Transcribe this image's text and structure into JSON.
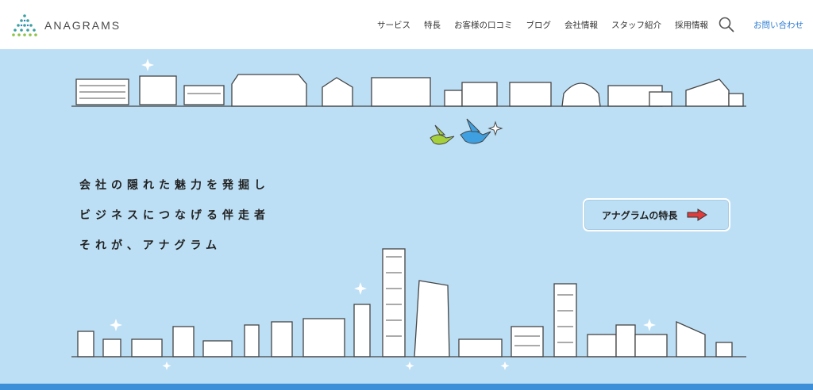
{
  "header": {
    "logo_text": "ANAGRAMS",
    "nav": [
      {
        "label": "サービス"
      },
      {
        "label": "特長"
      },
      {
        "label": "お客様の口コミ"
      },
      {
        "label": "ブログ"
      },
      {
        "label": "会社情報"
      },
      {
        "label": "スタッフ紹介"
      },
      {
        "label": "採用情報"
      }
    ],
    "search_icon": "search-icon",
    "contact_label": "お問い合わせ"
  },
  "hero": {
    "catch_lines": [
      "会社の隠れた魅力を発掘し",
      "ビジネスにつなげる伴走者",
      "それが、アナグラム"
    ],
    "feature_button_label": "アナグラムの特長",
    "arrow_icon": "arrow-right-icon",
    "colors": {
      "sky": "#bcdff5",
      "accent_blue": "#2a7bd1",
      "arrow_red": "#e03c3c",
      "bottom_bar": "#3d8fd8"
    }
  }
}
